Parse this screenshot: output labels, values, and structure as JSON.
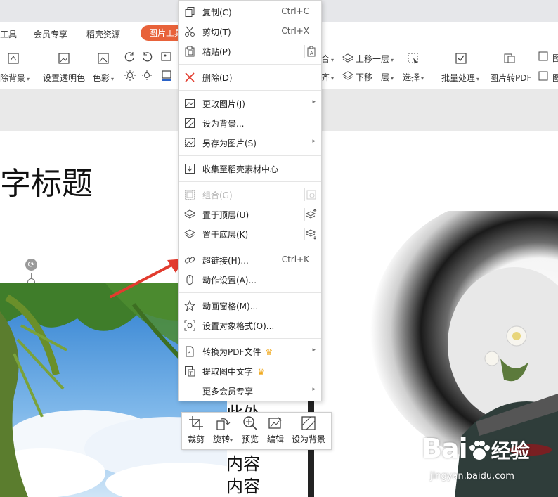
{
  "tabs": {
    "tools_partial": "工具",
    "member": "会员专享",
    "daoke": "稻壳资源",
    "picture_tools": "图片工具"
  },
  "ribbon": {
    "remove_bg": "除背景",
    "set_transparent": "设置透明色",
    "color": "色彩",
    "combine_partial": "合",
    "align_partial": "齐",
    "bring_forward": "上移一层",
    "send_backward": "下移一层",
    "select": "选择",
    "batch": "批量处理",
    "to_pdf": "图片转PDF",
    "partial_right": "图"
  },
  "slide": {
    "title": "字标题",
    "text_lines": [
      "此处",
      "内容",
      "内容"
    ]
  },
  "context_menu": {
    "items": [
      {
        "id": "copy",
        "label": "复制(C)",
        "shortcut": "Ctrl+C",
        "icon": "copy-icon"
      },
      {
        "id": "cut",
        "label": "剪切(T)",
        "shortcut": "Ctrl+X",
        "icon": "scissors-icon"
      },
      {
        "id": "paste",
        "label": "粘贴(P)",
        "icon": "paste-icon"
      },
      {
        "id": "delete",
        "label": "删除(D)",
        "icon": "delete-x-icon"
      },
      {
        "id": "change_picture",
        "label": "更改图片(J)",
        "icon": "change-picture-icon"
      },
      {
        "id": "set_background",
        "label": "设为背景...",
        "icon": "background-icon"
      },
      {
        "id": "save_as_picture",
        "label": "另存为图片(S)",
        "icon": "save-picture-icon"
      },
      {
        "id": "collect",
        "label": "收集至稻壳素材中心",
        "icon": "collect-icon"
      },
      {
        "id": "group",
        "label": "组合(G)",
        "icon": "group-icon"
      },
      {
        "id": "bring_to_front",
        "label": "置于顶层(U)",
        "icon": "layers-up-icon"
      },
      {
        "id": "send_to_back",
        "label": "置于底层(K)",
        "icon": "layers-down-icon"
      },
      {
        "id": "hyperlink",
        "label": "超链接(H)...",
        "shortcut": "Ctrl+K",
        "icon": "link-icon"
      },
      {
        "id": "action",
        "label": "动作设置(A)...",
        "icon": "mouse-icon"
      },
      {
        "id": "animation_pane",
        "label": "动画窗格(M)...",
        "icon": "star-icon"
      },
      {
        "id": "format_object",
        "label": "设置对象格式(O)...",
        "icon": "format-icon"
      },
      {
        "id": "convert_pdf",
        "label": "转换为PDF文件",
        "icon": "pdf-icon"
      },
      {
        "id": "extract_text",
        "label": "提取图中文字",
        "icon": "ocr-icon"
      },
      {
        "id": "more_member",
        "label": "更多会员专享"
      }
    ]
  },
  "float_toolbar": {
    "crop": "裁剪",
    "rotate": "旋转",
    "preview": "预览",
    "edit": "编辑",
    "set_bg": "设为背景"
  },
  "watermark": {
    "brand": "Bai",
    "brand_cn": "经验",
    "url": "jingyan.baidu.com"
  },
  "colors": {
    "accent": "#e8623a",
    "red_arrow": "#e23b2e",
    "crown": "#f0a91f"
  }
}
